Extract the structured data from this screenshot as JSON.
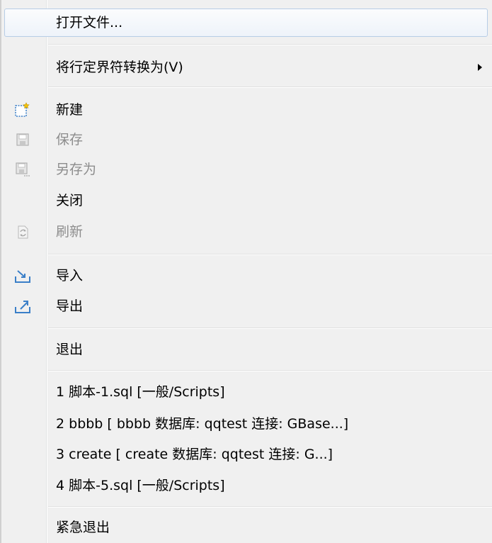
{
  "menu": {
    "open_file": "打开文件...",
    "convert_line_delimiters": "将行定界符转换为(V)",
    "new": "新建",
    "save": "保存",
    "save_as": "另存为",
    "close": "关闭",
    "refresh": "刷新",
    "import": "导入",
    "export": "导出",
    "exit": "退出",
    "recent_files": [
      "1 脚本-1.sql  [一般/Scripts]",
      "2 bbbb  [ bbbb 数据库: qqtest 连接: GBase...]",
      "3 create  [ create 数据库: qqtest 连接: G...]",
      "4 脚本-5.sql  [一般/Scripts]"
    ],
    "emergency_exit": "紧急退出"
  },
  "icons": {
    "new": "new-file-icon",
    "save": "save-icon",
    "save_as": "save-as-icon",
    "refresh": "refresh-icon",
    "import": "import-icon",
    "export": "export-icon",
    "submenu": "chevron-right-icon"
  },
  "colors": {
    "background": "#f0f0f0",
    "disabled_text": "#8d8d8d",
    "highlight_border": "#b7cde6",
    "icon_blue": "#3a7fc8"
  }
}
